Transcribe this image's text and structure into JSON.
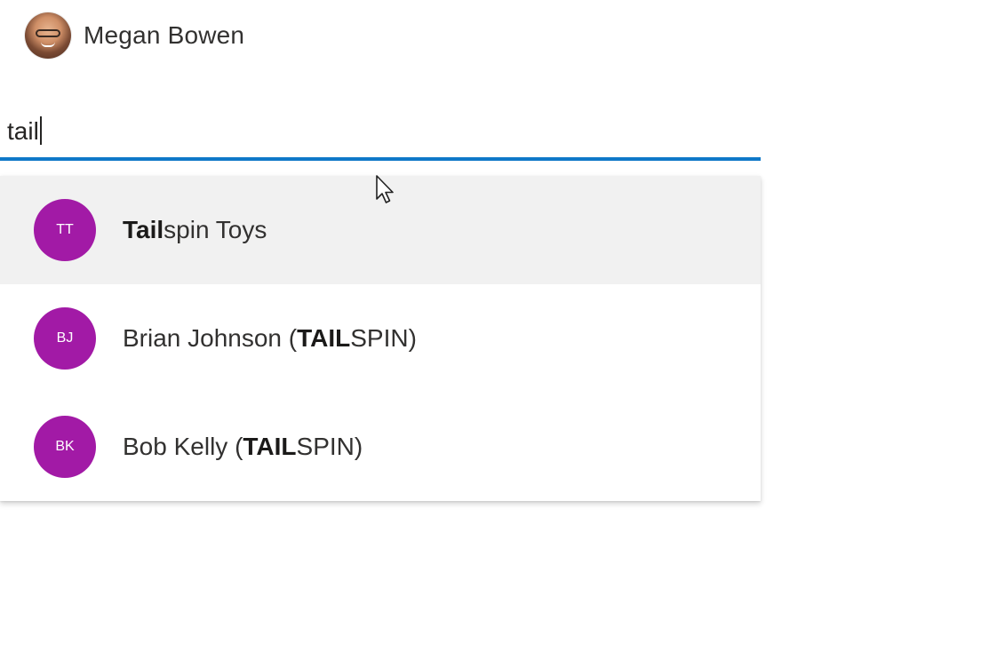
{
  "header": {
    "user_name": "Megan Bowen"
  },
  "search": {
    "value": "tail"
  },
  "suggestions": [
    {
      "initials": "TT",
      "name_match": "Tail",
      "name_rest": "spin Toys",
      "name_prefix": "",
      "name_suffix": "",
      "hovered": true
    },
    {
      "initials": "BJ",
      "name_prefix": "Brian Johnson (",
      "name_match": "TAIL",
      "name_rest": "SPIN)",
      "hovered": false
    },
    {
      "initials": "BK",
      "name_prefix": "Bob Kelly (",
      "name_match": "TAIL",
      "name_rest": "SPIN)",
      "hovered": false
    }
  ],
  "colors": {
    "accent": "#0f78c8",
    "persona": "#a21aa6",
    "hover": "#f1f1f1"
  },
  "icons": {
    "cursor": "mouse-pointer-icon"
  }
}
